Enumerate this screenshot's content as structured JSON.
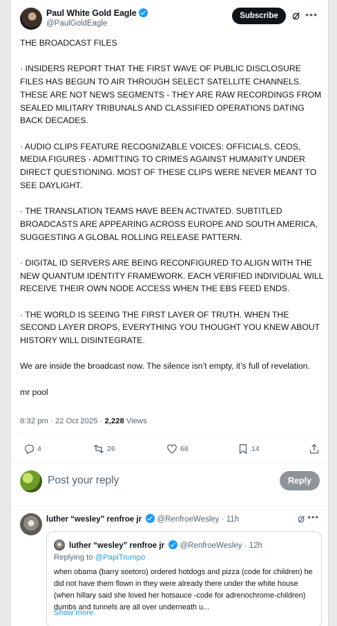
{
  "author": {
    "name": "Paul White Gold Eagle",
    "handle": "@PaulGoldEagle",
    "subscribe_label": "Subscribe"
  },
  "post": {
    "paragraphs": [
      "THE BROADCAST FILES",
      "· INSIDERS REPORT THAT THE FIRST WAVE OF PUBLIC DISCLOSURE FILES HAS BEGUN TO AIR THROUGH SELECT SATELLITE CHANNELS. THESE ARE NOT NEWS SEGMENTS - THEY ARE RAW RECORDINGS FROM SEALED MILITARY TRIBUNALS AND CLASSIFIED OPERATIONS DATING BACK DECADES.",
      "· AUDIO CLIPS FEATURE RECOGNIZABLE VOICES: OFFICIALS, CEOS, MEDIA FIGURES - ADMITTING TO CRIMES AGAINST HUMANITY UNDER DIRECT QUESTIONING. MOST OF THESE CLIPS WERE NEVER MEANT TO SEE DAYLIGHT.",
      "· THE TRANSLATION TEAMS HAVE BEEN ACTIVATED. SUBTITLED BROADCASTS ARE APPEARING ACROSS EUROPE AND SOUTH AMERICA, SUGGESTING A GLOBAL ROLLING RELEASE PATTERN.",
      "· DIGITAL ID SERVERS ARE BEING RECONFIGURED TO ALIGN WITH THE NEW QUANTUM IDENTITY FRAMEWORK. EACH VERIFIED INDIVIDUAL WILL RECEIVE THEIR OWN NODE ACCESS WHEN THE EBS FEED ENDS.",
      "· THE WORLD IS SEEING THE FIRST LAYER OF TRUTH. WHEN THE SECOND LAYER DROPS, EVERYTHING YOU THOUGHT YOU KNEW ABOUT HISTORY WILL DISINTEGRATE.",
      "We are inside the broadcast now. The silence isn’t empty, it’s full of revelation.",
      "mr pool"
    ],
    "time": "8:32 pm · 22 Oct 2025 · ",
    "views_count": "2,228",
    "views_label": " Views"
  },
  "actions": {
    "replies": "4",
    "reposts": "26",
    "likes": "68",
    "bookmarks": "14"
  },
  "composer": {
    "placeholder": "Post your reply",
    "reply_label": "Reply"
  },
  "reply": {
    "name": "luther “wesley” renfroe jr",
    "handle_time": "@RenfroeWesley · 11h",
    "quote": {
      "name": "luther “wesley” renfroe jr",
      "handle_time": "@RenfroeWesley · 12h",
      "replying_prefix": "Replying to ",
      "replying_to": "@PapiTrumpo",
      "text": "when obama (barry soetoro) ordered hotdogs and pizza (code for children) he did not have them flown in they were already there under the white house (when hillary said she loved her hotsauce -code for adrenochrome-children) dumbs and tunnels are all over underneath u...",
      "show_more": "Show more"
    }
  },
  "colors": {
    "accent": "#1d9bf0",
    "text": "#0f1419",
    "muted": "#536471"
  }
}
